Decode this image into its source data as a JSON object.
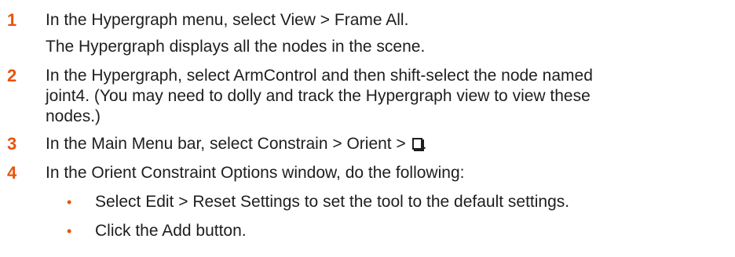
{
  "colors": {
    "accent": "#e8540c",
    "text": "#1e1e1e"
  },
  "steps": [
    {
      "number": "1",
      "lines": [
        "In the Hypergraph menu, select View > Frame All."
      ],
      "note": "The Hypergraph displays all the nodes in the scene."
    },
    {
      "number": "2",
      "lines": [
        "In the Hypergraph, select ArmControl and then shift-select the node named",
        "joint4. (You may need to dolly and track the Hypergraph view to view these",
        "nodes.)"
      ]
    },
    {
      "number": "3",
      "lines": [
        "In the Main Menu bar, select Constrain > Orient > "
      ],
      "icon": "option-box-icon"
    },
    {
      "number": "4",
      "lines": [
        "In the Orient Constraint Options window, do the following:"
      ],
      "bullets": [
        "Select Edit > Reset Settings to set the tool to the default settings.",
        "Click the Add button."
      ],
      "bullet_glyph": "•"
    }
  ]
}
